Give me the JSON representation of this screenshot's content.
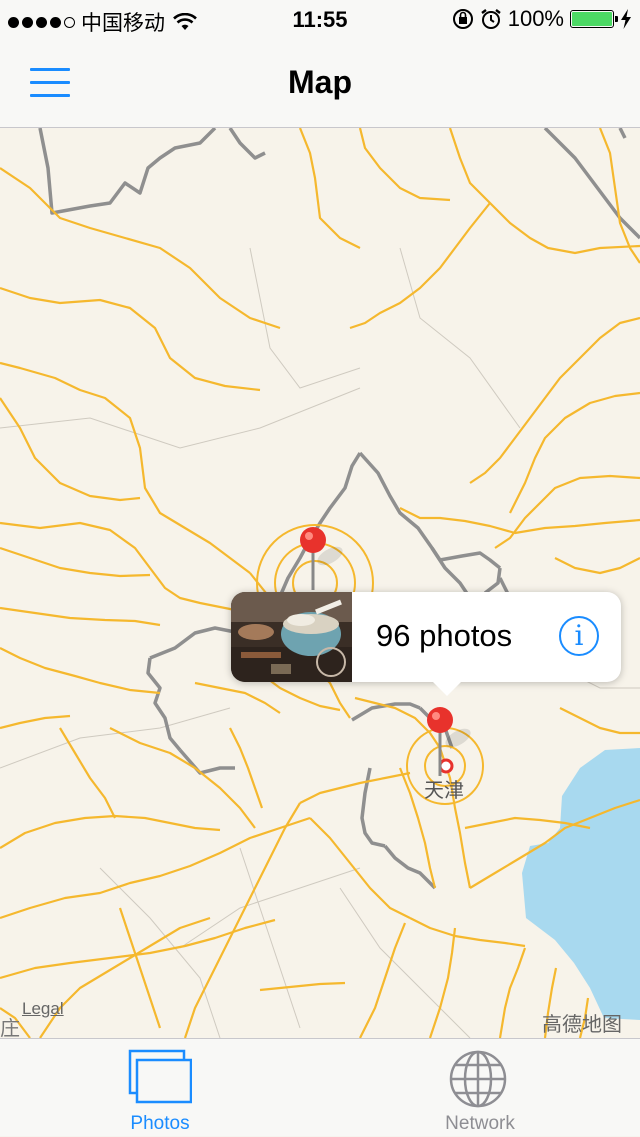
{
  "status_bar": {
    "carrier": "中国移动",
    "time": "11:55",
    "battery": "100%",
    "signal_bars_filled": 4,
    "signal_bars_total": 5
  },
  "nav": {
    "title": "Map",
    "menu_icon": "hamburger-menu-icon"
  },
  "map": {
    "callout": {
      "text": "96 photos",
      "info_icon": "info-icon",
      "info_glyph": "i"
    },
    "city_label": "天津",
    "legal": "Legal",
    "cut_label": "庄",
    "provider": "高德地图",
    "pins": [
      "red-pin",
      "red-pin"
    ]
  },
  "tab_bar": {
    "tabs": [
      {
        "label": "Photos",
        "icon": "photos-icon",
        "selected": true
      },
      {
        "label": "Network",
        "icon": "globe-icon",
        "selected": false
      }
    ]
  },
  "colors": {
    "accent": "#1a8cff",
    "road": "#f5b82e",
    "border": "#8f8f8f",
    "water": "#a8d9ef",
    "pin": "#e8322c",
    "battery": "#4cd964"
  }
}
